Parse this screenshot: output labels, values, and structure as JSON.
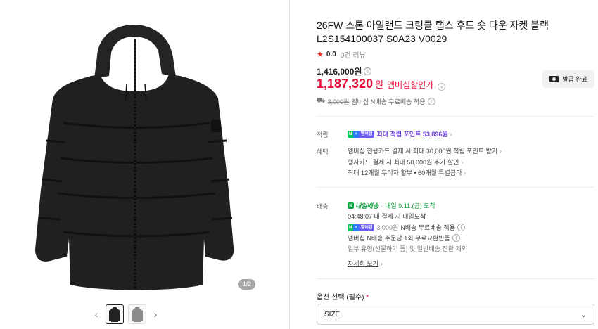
{
  "gallery": {
    "counter": "1/2",
    "prev_icon": "chevron-left-icon",
    "next_icon": "chevron-right-icon",
    "thumb_count": 2,
    "active_thumb": 1
  },
  "product": {
    "title_line1": "26FW 스톤 아일랜드 크링클 랩스 후드 숏 다운 자켓 블랙",
    "title_line2": "L2S154100037 S0A23 V0029",
    "rating": "0.0",
    "reviews": "0건 리뷰",
    "original_price": "1,416,000원",
    "sale_price": "1,187,320",
    "sale_won": "원",
    "sale_label": "멤버십할인가",
    "coupon_button": "발급 완료",
    "shipping_strike": "3,000원",
    "shipping_text": "멤버십 N배송 무료배송 적용"
  },
  "benefits": {
    "points_label": "적립",
    "points_badge_n": "N",
    "points_badge_plus": "+",
    "points_badge_m": "멤버십",
    "points_text": "최대 적립 포인트 53,896원",
    "benefit_label": "혜택",
    "lines": [
      "멤버십 전용카드 결제 시 최대 30,000원 적립 포인트 받기",
      "행사카드 결제 시 최대 50,000원 추가 할인",
      "최대 12개월 무이자 할부 • 60개월 특별금리"
    ]
  },
  "delivery": {
    "label": "배송",
    "tag": "내일배송",
    "arrival": "내일 9.11.(금) 도착",
    "deadline": "04:48:07  내 결제 시 내일도착",
    "n_strike": "3,000원",
    "n_text": "N배송 무료배송 적용",
    "exchange": "멤버십 N배송 주문당 1회 무료교환반품",
    "note": "일부 유형(선물하기 등) 및 일반배송 전환 제외",
    "more": "자세히 보기"
  },
  "option": {
    "label": "옵션 선택 (필수)",
    "required_mark": "*",
    "select_value": "SIZE"
  },
  "colors": {
    "sale_red": "#e60c3a",
    "naver_green": "#03c75a",
    "points_purple": "#6b3fdc"
  }
}
